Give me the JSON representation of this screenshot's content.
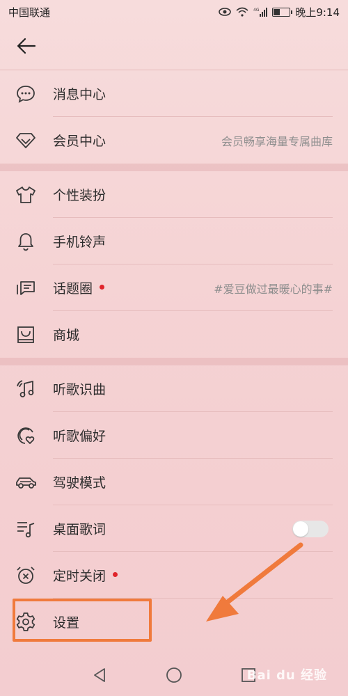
{
  "status": {
    "carrier": "中国联通",
    "time": "晚上9:14",
    "signal_tag": "4G",
    "battery_level": 0.35
  },
  "header": {
    "back_icon": "arrow-left-icon"
  },
  "menu": {
    "items": [
      {
        "label": "消息中心",
        "icon": "message-bubble-icon",
        "sub": ""
      },
      {
        "label": "会员中心",
        "icon": "diamond-icon",
        "sub": "会员畅享海量专属曲库"
      },
      {
        "label": "个性装扮",
        "icon": "tshirt-icon",
        "sub": ""
      },
      {
        "label": "手机铃声",
        "icon": "bell-icon",
        "sub": ""
      },
      {
        "label": "话题圈",
        "icon": "chat-topic-icon",
        "sub": "#爱豆做过最暖心的事#",
        "badge": true
      },
      {
        "label": "商城",
        "icon": "shopping-bag-icon",
        "sub": ""
      },
      {
        "label": "听歌识曲",
        "icon": "music-recognize-icon",
        "sub": ""
      },
      {
        "label": "听歌偏好",
        "icon": "music-heart-icon",
        "sub": ""
      },
      {
        "label": "驾驶模式",
        "icon": "car-icon",
        "sub": ""
      },
      {
        "label": "桌面歌词",
        "icon": "lyrics-icon",
        "sub": "",
        "toggle": false
      },
      {
        "label": "定时关闭",
        "icon": "alarm-clock-icon",
        "sub": "",
        "badge": true
      },
      {
        "label": "设置",
        "icon": "gear-icon",
        "sub": ""
      }
    ]
  },
  "colors": {
    "accent_orange": "#f07a3c",
    "badge_red": "#e0242b"
  },
  "watermark": "Bai du 经验"
}
